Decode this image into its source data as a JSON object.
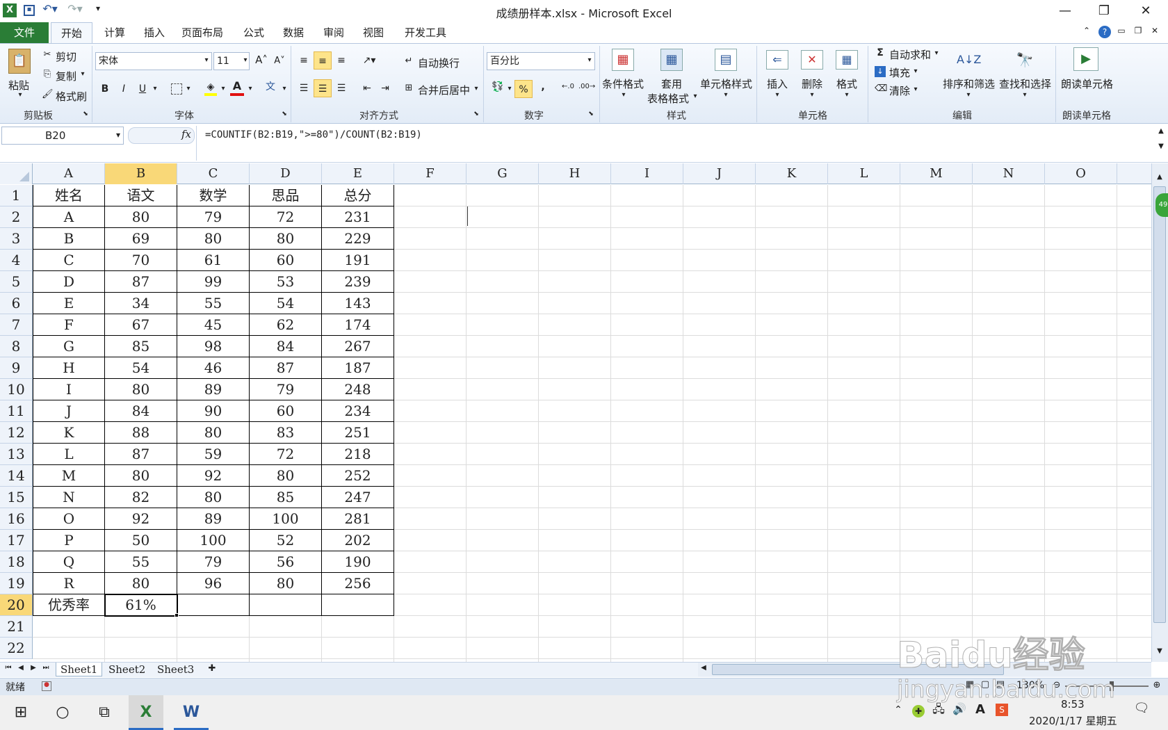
{
  "app": {
    "title": "成绩册样本.xlsx - Microsoft Excel"
  },
  "tabs": [
    "文件",
    "开始",
    "计算",
    "插入",
    "页面布局",
    "公式",
    "数据",
    "审阅",
    "视图",
    "开发工具"
  ],
  "clipboard": {
    "paste": "粘贴",
    "cut": "剪切",
    "copy": "复制",
    "painter": "格式刷",
    "group": "剪贴板"
  },
  "font": {
    "name": "宋体",
    "size": "11",
    "bold": "B",
    "italic": "I",
    "underline": "U",
    "group": "字体"
  },
  "alignment": {
    "wrap": "自动换行",
    "merge": "合并后居中",
    "group": "对齐方式"
  },
  "number": {
    "format": "百分比",
    "percent": "%",
    "comma": ",",
    "group": "数字"
  },
  "styles": {
    "cond": "条件格式",
    "table_line1": "套用",
    "table_line2": "表格格式",
    "cell": "单元格样式",
    "group": "样式"
  },
  "cells": {
    "insert": "插入",
    "delete": "删除",
    "format": "格式",
    "group": "单元格"
  },
  "editing": {
    "autosum": "自动求和",
    "fill": "填充",
    "clear": "清除",
    "sort": "排序和筛选",
    "find": "查找和选择",
    "group": "编辑"
  },
  "read": {
    "button": "朗读单元格",
    "group": "朗读单元格"
  },
  "formula_bar": {
    "name_box": "B20",
    "fx": "fx",
    "formula": "=COUNTIF(B2:B19,\">=80\")/COUNT(B2:B19)"
  },
  "columns": [
    "A",
    "B",
    "C",
    "D",
    "E",
    "F",
    "G",
    "H",
    "I",
    "J",
    "K",
    "L",
    "M",
    "N",
    "O"
  ],
  "rows": [
    "1",
    "2",
    "3",
    "4",
    "5",
    "6",
    "7",
    "8",
    "9",
    "10",
    "11",
    "12",
    "13",
    "14",
    "15",
    "16",
    "17",
    "18",
    "19",
    "20",
    "21",
    "22"
  ],
  "table": {
    "header": [
      "姓名",
      "语文",
      "数学",
      "思品",
      "总分"
    ],
    "data": [
      [
        "A",
        "80",
        "79",
        "72",
        "231"
      ],
      [
        "B",
        "69",
        "80",
        "80",
        "229"
      ],
      [
        "C",
        "70",
        "61",
        "60",
        "191"
      ],
      [
        "D",
        "87",
        "99",
        "53",
        "239"
      ],
      [
        "E",
        "34",
        "55",
        "54",
        "143"
      ],
      [
        "F",
        "67",
        "45",
        "62",
        "174"
      ],
      [
        "G",
        "85",
        "98",
        "84",
        "267"
      ],
      [
        "H",
        "54",
        "46",
        "87",
        "187"
      ],
      [
        "I",
        "80",
        "89",
        "79",
        "248"
      ],
      [
        "J",
        "84",
        "90",
        "60",
        "234"
      ],
      [
        "K",
        "88",
        "80",
        "83",
        "251"
      ],
      [
        "L",
        "87",
        "59",
        "72",
        "218"
      ],
      [
        "M",
        "80",
        "92",
        "80",
        "252"
      ],
      [
        "N",
        "82",
        "80",
        "85",
        "247"
      ],
      [
        "O",
        "92",
        "89",
        "100",
        "281"
      ],
      [
        "P",
        "50",
        "100",
        "52",
        "202"
      ],
      [
        "Q",
        "55",
        "79",
        "56",
        "190"
      ],
      [
        "R",
        "80",
        "96",
        "80",
        "256"
      ]
    ],
    "footer": [
      "优秀率",
      "61%",
      "",
      "",
      ""
    ]
  },
  "sheets": [
    "Sheet1",
    "Sheet2",
    "Sheet3"
  ],
  "status": {
    "ready": "就绪",
    "zoom": "130%"
  },
  "taskbar": {
    "time": "8:53",
    "date": "2020/1/17 星期五",
    "ime": "A"
  },
  "watermark": {
    "brand": "Baidu经验",
    "url": "jingyan.baidu.com"
  },
  "colors": {
    "file_tab": "#2a7d36",
    "selected_header": "#f9d878",
    "ribbon": "#e3ecf7"
  }
}
